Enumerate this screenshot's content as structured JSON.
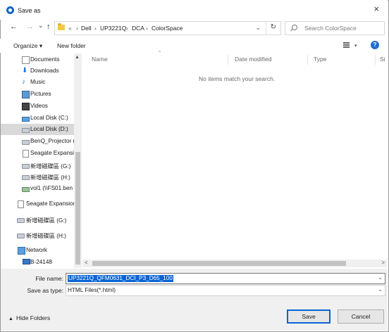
{
  "window": {
    "title": "Save as",
    "close_glyph": "×"
  },
  "nav": {
    "back_glyph": "←",
    "forward_glyph": "→",
    "recent_glyph": "⌄",
    "up_glyph": "↑",
    "breadcrumb": [
      "«",
      "Dell",
      "UP3221Q",
      "DCA",
      "ColorSpace"
    ],
    "separator": "›",
    "dropdown_glyph": "⌄",
    "refresh_glyph": "↻"
  },
  "search": {
    "placeholder": "Search ColorSpace"
  },
  "toolbar": {
    "organize_label": "Organize ▾",
    "new_folder_label": "New folder",
    "help_label": "?",
    "view_caret": "▾"
  },
  "sidebar": {
    "items": [
      {
        "label": "Documents",
        "icon": "documents-icon"
      },
      {
        "label": "Downloads",
        "icon": "downloads-icon"
      },
      {
        "label": "Music",
        "icon": "music-icon"
      },
      {
        "label": "Pictures",
        "icon": "pictures-icon"
      },
      {
        "label": "Videos",
        "icon": "videos-icon"
      },
      {
        "label": "Local Disk (C:)",
        "icon": "system-drive-icon"
      },
      {
        "label": "Local Disk (D:)",
        "icon": "drive-icon",
        "selected": true
      },
      {
        "label": "BenQ_Projector (",
        "icon": "drive-icon"
      },
      {
        "label": "Seagate Expansic",
        "icon": "page-icon"
      },
      {
        "label": "新增磁碟區 (G:)",
        "icon": "drive-icon"
      },
      {
        "label": "新增磁碟區 (H:)",
        "icon": "drive-icon"
      },
      {
        "label": "vol1 (\\\\FS01.ben",
        "icon": "network-drive-icon"
      },
      {
        "label": "Seagate Expansion",
        "icon": "page-icon"
      },
      {
        "label": "新增磁碟區 (G:)",
        "icon": "drive-icon"
      },
      {
        "label": "新增磁碟區 (H:)",
        "icon": "drive-icon"
      },
      {
        "label": "Network",
        "icon": "network-icon"
      },
      {
        "label": "B-24148",
        "icon": "computer-icon"
      }
    ]
  },
  "content": {
    "columns": [
      "Name",
      "Date modified",
      "Type",
      "Si"
    ],
    "empty_message": "No items match your search."
  },
  "form": {
    "file_name_label": "File name:",
    "file_name_value": "UP3221Q_QFM0631_DCI_P3_D65_100",
    "save_as_type_label": "Save as type:",
    "save_as_type_value": "HTML Files(*.html)",
    "dropdown_glyph": "⌄"
  },
  "footer": {
    "hide_folders_label": "Hide Folders",
    "hide_folders_glyph": "▲",
    "save_label": "Save",
    "cancel_label": "Cancel"
  },
  "scroll": {
    "up_glyph": "▲",
    "left_glyph": "<",
    "right_glyph": ">"
  }
}
